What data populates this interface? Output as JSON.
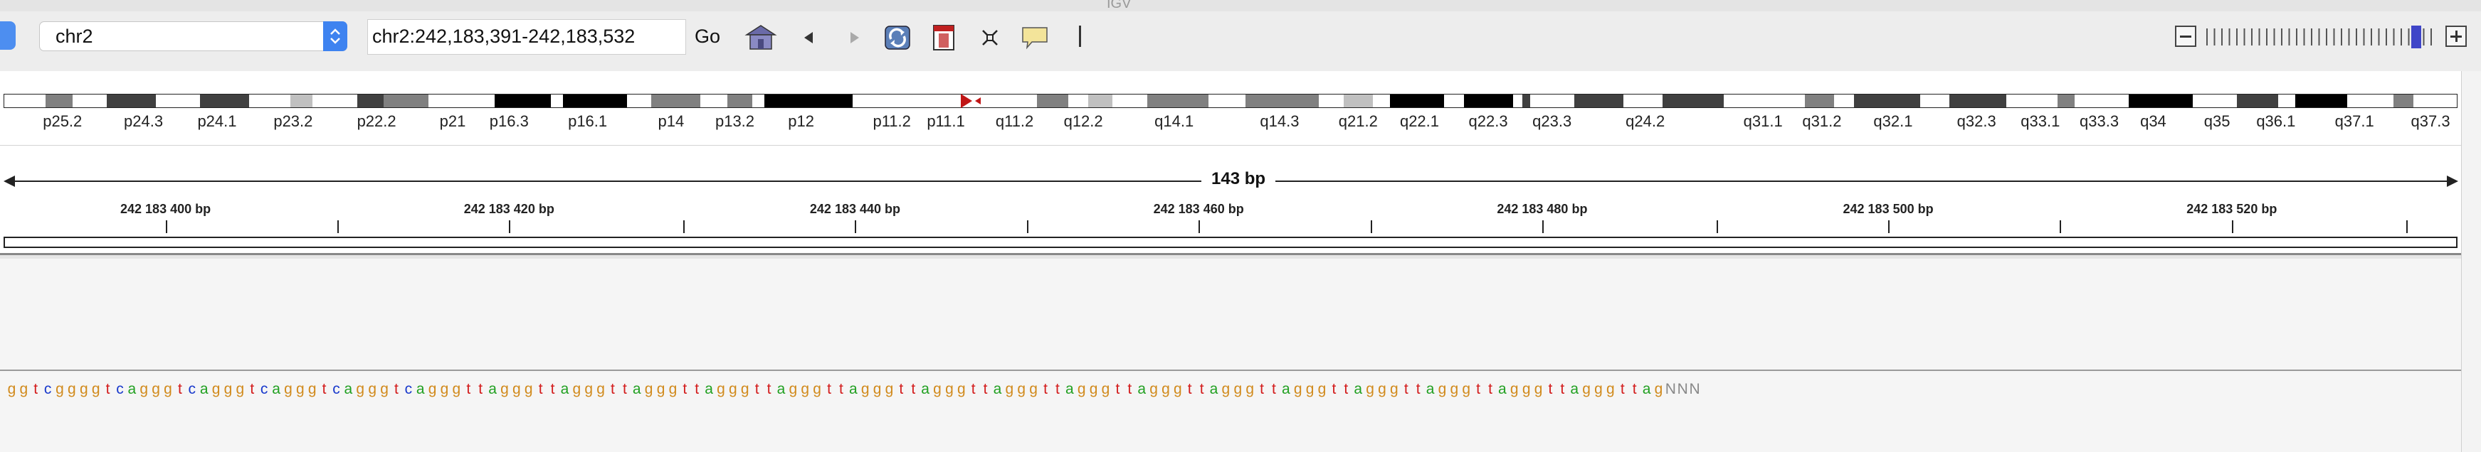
{
  "window_title": "IGV",
  "toolbar": {
    "genome": "chr2",
    "locus": "chr2:242,183,391-242,183,532",
    "go_label": "Go"
  },
  "colors": {
    "A": "#21a021",
    "C": "#1a3acc",
    "G": "#d18a1c",
    "T": "#d31d1d",
    "N": "#888888",
    "centromere": "#c01616"
  },
  "ideogram": {
    "bands": [
      {
        "f": 0.0,
        "w": 0.017,
        "c": "#ffffff"
      },
      {
        "f": 0.017,
        "w": 0.011,
        "c": "#808080"
      },
      {
        "f": 0.028,
        "w": 0.014,
        "c": "#ffffff"
      },
      {
        "f": 0.042,
        "w": 0.02,
        "c": "#404040"
      },
      {
        "f": 0.062,
        "w": 0.018,
        "c": "#ffffff"
      },
      {
        "f": 0.08,
        "w": 0.02,
        "c": "#404040"
      },
      {
        "f": 0.1,
        "w": 0.017,
        "c": "#ffffff"
      },
      {
        "f": 0.117,
        "w": 0.009,
        "c": "#c0c0c0"
      },
      {
        "f": 0.126,
        "w": 0.018,
        "c": "#ffffff"
      },
      {
        "f": 0.144,
        "w": 0.011,
        "c": "#404040"
      },
      {
        "f": 0.155,
        "w": 0.018,
        "c": "#808080"
      },
      {
        "f": 0.173,
        "w": 0.027,
        "c": "#ffffff"
      },
      {
        "f": 0.2,
        "w": 0.023,
        "c": "#000000"
      },
      {
        "f": 0.223,
        "w": 0.005,
        "c": "#ffffff"
      },
      {
        "f": 0.228,
        "w": 0.026,
        "c": "#000000"
      },
      {
        "f": 0.254,
        "w": 0.01,
        "c": "#ffffff"
      },
      {
        "f": 0.264,
        "w": 0.02,
        "c": "#808080"
      },
      {
        "f": 0.284,
        "w": 0.011,
        "c": "#ffffff"
      },
      {
        "f": 0.295,
        "w": 0.01,
        "c": "#808080"
      },
      {
        "f": 0.305,
        "w": 0.005,
        "c": "#ffffff"
      },
      {
        "f": 0.31,
        "w": 0.036,
        "c": "#000000"
      },
      {
        "f": 0.346,
        "w": 0.035,
        "c": "#ffffff"
      },
      {
        "f": 0.381,
        "w": 0.009,
        "c": "#ffffff"
      },
      {
        "f": 0.404,
        "w": 0.017,
        "c": "#ffffff"
      },
      {
        "f": 0.421,
        "w": 0.013,
        "c": "#808080"
      },
      {
        "f": 0.434,
        "w": 0.008,
        "c": "#ffffff"
      },
      {
        "f": 0.442,
        "w": 0.01,
        "c": "#c0c0c0"
      },
      {
        "f": 0.452,
        "w": 0.014,
        "c": "#ffffff"
      },
      {
        "f": 0.466,
        "w": 0.025,
        "c": "#808080"
      },
      {
        "f": 0.491,
        "w": 0.015,
        "c": "#ffffff"
      },
      {
        "f": 0.506,
        "w": 0.03,
        "c": "#808080"
      },
      {
        "f": 0.536,
        "w": 0.01,
        "c": "#ffffff"
      },
      {
        "f": 0.546,
        "w": 0.012,
        "c": "#c0c0c0"
      },
      {
        "f": 0.558,
        "w": 0.007,
        "c": "#ffffff"
      },
      {
        "f": 0.565,
        "w": 0.022,
        "c": "#000000"
      },
      {
        "f": 0.587,
        "w": 0.008,
        "c": "#ffffff"
      },
      {
        "f": 0.595,
        "w": 0.02,
        "c": "#000000"
      },
      {
        "f": 0.615,
        "w": 0.004,
        "c": "#ffffff"
      },
      {
        "f": 0.619,
        "w": 0.003,
        "c": "#404040"
      },
      {
        "f": 0.622,
        "w": 0.018,
        "c": "#ffffff"
      },
      {
        "f": 0.64,
        "w": 0.02,
        "c": "#404040"
      },
      {
        "f": 0.66,
        "w": 0.016,
        "c": "#ffffff"
      },
      {
        "f": 0.676,
        "w": 0.025,
        "c": "#404040"
      },
      {
        "f": 0.701,
        "w": 0.033,
        "c": "#ffffff"
      },
      {
        "f": 0.734,
        "w": 0.012,
        "c": "#808080"
      },
      {
        "f": 0.746,
        "w": 0.008,
        "c": "#ffffff"
      },
      {
        "f": 0.754,
        "w": 0.027,
        "c": "#404040"
      },
      {
        "f": 0.781,
        "w": 0.012,
        "c": "#ffffff"
      },
      {
        "f": 0.793,
        "w": 0.023,
        "c": "#404040"
      },
      {
        "f": 0.816,
        "w": 0.021,
        "c": "#ffffff"
      },
      {
        "f": 0.837,
        "w": 0.007,
        "c": "#808080"
      },
      {
        "f": 0.844,
        "w": 0.022,
        "c": "#ffffff"
      },
      {
        "f": 0.866,
        "w": 0.026,
        "c": "#000000"
      },
      {
        "f": 0.892,
        "w": 0.018,
        "c": "#ffffff"
      },
      {
        "f": 0.91,
        "w": 0.017,
        "c": "#404040"
      },
      {
        "f": 0.927,
        "w": 0.007,
        "c": "#ffffff"
      },
      {
        "f": 0.934,
        "w": 0.021,
        "c": "#000000"
      },
      {
        "f": 0.955,
        "w": 0.019,
        "c": "#ffffff"
      },
      {
        "f": 0.974,
        "w": 0.008,
        "c": "#808080"
      },
      {
        "f": 0.982,
        "w": 0.018,
        "c": "#ffffff"
      }
    ],
    "band_labels": [
      {
        "t": "p25.2",
        "x": 0.024
      },
      {
        "t": "p24.3",
        "x": 0.057
      },
      {
        "t": "p24.1",
        "x": 0.087
      },
      {
        "t": "p23.2",
        "x": 0.118
      },
      {
        "t": "p22.2",
        "x": 0.152
      },
      {
        "t": "p21",
        "x": 0.183
      },
      {
        "t": "p16.3",
        "x": 0.206
      },
      {
        "t": "p16.1",
        "x": 0.238
      },
      {
        "t": "p14",
        "x": 0.272
      },
      {
        "t": "p13.2",
        "x": 0.298
      },
      {
        "t": "p12",
        "x": 0.325
      },
      {
        "t": "p11.2",
        "x": 0.362
      },
      {
        "t": "p11.1",
        "x": 0.384
      },
      {
        "t": "q11.2",
        "x": 0.412
      },
      {
        "t": "q12.2",
        "x": 0.44
      },
      {
        "t": "q14.1",
        "x": 0.477
      },
      {
        "t": "q14.3",
        "x": 0.52
      },
      {
        "t": "q21.2",
        "x": 0.552
      },
      {
        "t": "q22.1",
        "x": 0.577
      },
      {
        "t": "q22.3",
        "x": 0.605
      },
      {
        "t": "q23.3",
        "x": 0.631
      },
      {
        "t": "q24.2",
        "x": 0.669
      },
      {
        "t": "q31.1",
        "x": 0.717
      },
      {
        "t": "q31.2",
        "x": 0.741
      },
      {
        "t": "q32.1",
        "x": 0.77
      },
      {
        "t": "q32.3",
        "x": 0.804
      },
      {
        "t": "q33.1",
        "x": 0.83
      },
      {
        "t": "q33.3",
        "x": 0.854
      },
      {
        "t": "q34",
        "x": 0.876
      },
      {
        "t": "q35",
        "x": 0.902
      },
      {
        "t": "q36.1",
        "x": 0.926
      },
      {
        "t": "q37.1",
        "x": 0.958
      },
      {
        "t": "q37.3",
        "x": 0.989
      }
    ]
  },
  "ruler": {
    "span_label": "143 bp",
    "labels": [
      {
        "t": "242 183 400 bp",
        "x": 0.066
      },
      {
        "t": "242 183 420 bp",
        "x": 0.206
      },
      {
        "t": "242 183 440 bp",
        "x": 0.347
      },
      {
        "t": "242 183 460 bp",
        "x": 0.487
      },
      {
        "t": "242 183 480 bp",
        "x": 0.627
      },
      {
        "t": "242 183 500 bp",
        "x": 0.768
      },
      {
        "t": "242 183 520 bp",
        "x": 0.908
      }
    ],
    "ticks": [
      0.066,
      0.136,
      0.206,
      0.277,
      0.347,
      0.417,
      0.487,
      0.557,
      0.627,
      0.698,
      0.768,
      0.838,
      0.908,
      0.979
    ]
  },
  "sequence": "ggtcggggtcagggtcagggtcagggtcagggtcagggttagggttagggttagggttagggttagggttagggttagggttagggttagggttagggttagggttagggttagggttagggttagggttagggttagNNN"
}
